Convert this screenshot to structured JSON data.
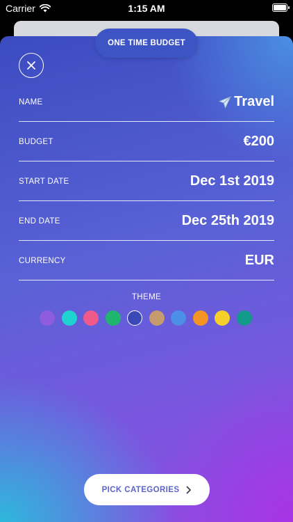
{
  "status_bar": {
    "carrier": "Carrier",
    "time": "1:15 AM",
    "wifi_icon": "wifi-icon",
    "battery_icon": "battery-icon"
  },
  "header": {
    "budget_type": "ONE TIME BUDGET",
    "close_icon": "close-icon"
  },
  "form": {
    "rows": [
      {
        "label": "NAME",
        "value": "Travel",
        "icon": "airplane-icon"
      },
      {
        "label": "BUDGET",
        "value": "€200"
      },
      {
        "label": "START DATE",
        "value": "Dec 1st 2019"
      },
      {
        "label": "END DATE",
        "value": "Dec 25th 2019"
      },
      {
        "label": "CURRENCY",
        "value": "EUR"
      }
    ]
  },
  "theme": {
    "label": "THEME",
    "colors": [
      "#8e5cde",
      "#1fd3d0",
      "#ef5a8a",
      "#1fb56e",
      "#3a49b5",
      "#c59b6d",
      "#4d8fe6",
      "#f59325",
      "#f7cf2a",
      "#13998a"
    ],
    "selected_index": 4
  },
  "footer": {
    "pick_categories_label": "PICK CATEGORIES",
    "chevron_icon": "chevron-right-icon"
  }
}
